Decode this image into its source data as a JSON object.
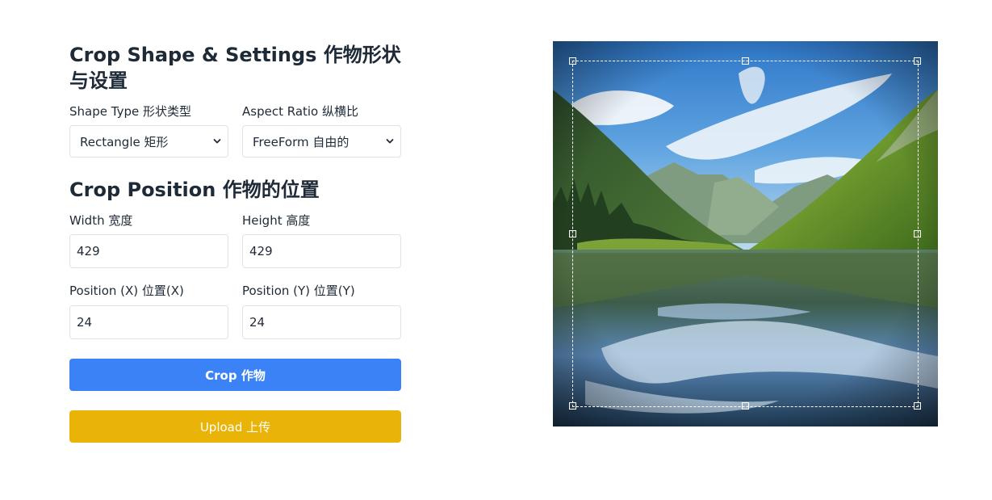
{
  "shape_settings": {
    "title": "Crop Shape & Settings 作物形状与设置",
    "shape_type": {
      "label": "Shape Type 形状类型",
      "selected": "Rectangle 矩形"
    },
    "aspect_ratio": {
      "label": "Aspect Ratio 纵横比",
      "selected": "FreeForm 自由的"
    }
  },
  "crop_position": {
    "title": "Crop Position 作物的位置",
    "width": {
      "label": "Width 宽度",
      "value": "429"
    },
    "height": {
      "label": "Height 高度",
      "value": "429"
    },
    "position_x": {
      "label": "Position (X) 位置(X)",
      "value": "24"
    },
    "position_y": {
      "label": "Position (Y) 位置(Y)",
      "value": "24"
    }
  },
  "actions": {
    "crop_label": "Crop 作物",
    "upload_label": "Upload 上传"
  },
  "colors": {
    "crop_button": "#3b82f6",
    "upload_button": "#eab308"
  },
  "image": {
    "icon": "landscape-lake-image"
  }
}
